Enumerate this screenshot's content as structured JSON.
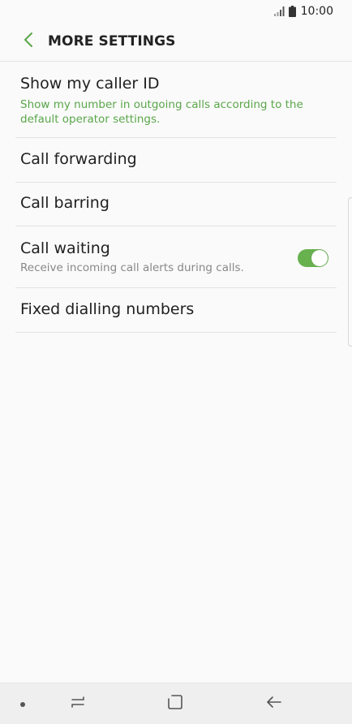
{
  "status_bar": {
    "time": "10:00",
    "icons": [
      "signal-icon",
      "battery-icon"
    ]
  },
  "app_bar": {
    "title": "MORE SETTINGS",
    "back_icon": "chevron-left-icon"
  },
  "settings": {
    "items": [
      {
        "title": "Show my caller ID",
        "summary": "Show my number in outgoing calls according to the default operator settings."
      },
      {
        "title": "Call forwarding"
      },
      {
        "title": "Call barring"
      },
      {
        "title": "Call waiting",
        "summary": "Receive incoming call alerts during calls.",
        "toggle_on": true
      },
      {
        "title": "Fixed dialling numbers"
      }
    ]
  },
  "nav_bar": {
    "icons": [
      "dot-icon",
      "recent-apps-icon",
      "home-icon",
      "back-arrow-icon"
    ]
  },
  "colors": {
    "accent": "#5aa64a",
    "toggle_on": "#67b14f",
    "background": "#fafafa",
    "divider": "#e2e2e2",
    "nav_background": "#efefef"
  }
}
